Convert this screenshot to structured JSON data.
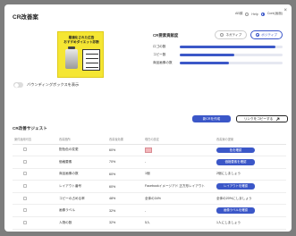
{
  "header": {
    "title": "CR改善案",
    "ab_label": "AB顔",
    "options": [
      "Help",
      "Cont(画面)"
    ],
    "close_icon": "close-icon"
  },
  "banner": {
    "line1": "最適化された広告",
    "line2": "おすすめダイエット診断"
  },
  "score": {
    "title": "CR要素貢献度",
    "segments": [
      "ネガティブ",
      "ポジティブ"
    ],
    "active_segment": "ポジティブ",
    "metrics": [
      {
        "label": "ロゴの数",
        "value": 0.93
      },
      {
        "label": "コピー数",
        "value": 0.53
      },
      {
        "label": "商品画像の数",
        "value": 0.48
      }
    ],
    "bar_color": "#3c58c8"
  },
  "toggle": {
    "label": "バウンディングボックスを表示",
    "on": false
  },
  "actions": {
    "primary": "新CRを作成",
    "secondary": "リンクをコピーする",
    "link_icon": "link-icon"
  },
  "suggest": {
    "title": "CR改善サジェスト",
    "columns": [
      "案件適用可否",
      "改善箇所",
      "改善後効果",
      "現在の設定",
      "改善案の提案"
    ],
    "rows": [
      {
        "item": "配色色の変更",
        "effect": "60%",
        "current": "",
        "swatch": true,
        "proposal": "色を確認",
        "proposal_button": true
      },
      {
        "item": "価格要素",
        "effect": "70%",
        "current": "-",
        "proposal": "価格要素を確認",
        "proposal_button": true
      },
      {
        "item": "商品画像の数",
        "effect": "60%",
        "current": "1個",
        "proposal": "2個にしましょう",
        "proposal_button": false
      },
      {
        "item": "レイアウト番号",
        "effect": "60%",
        "current": "Facebookイメージアド 正方形レイアウト",
        "proposal": "レイアウトを確認",
        "proposal_button": true
      },
      {
        "item": "コピーの占める率",
        "effect": "48%",
        "current": "全体の34%",
        "proposal": "全体の20%にしましょう",
        "proposal_button": false
      },
      {
        "item": "画像ラベル",
        "effect": "32%",
        "current": "-",
        "proposal": "画像ラベルを確認",
        "proposal_button": true
      },
      {
        "item": "人物の数",
        "effect": "32%",
        "current": "5人",
        "proposal": "1人にしましょう",
        "proposal_button": false
      }
    ]
  }
}
